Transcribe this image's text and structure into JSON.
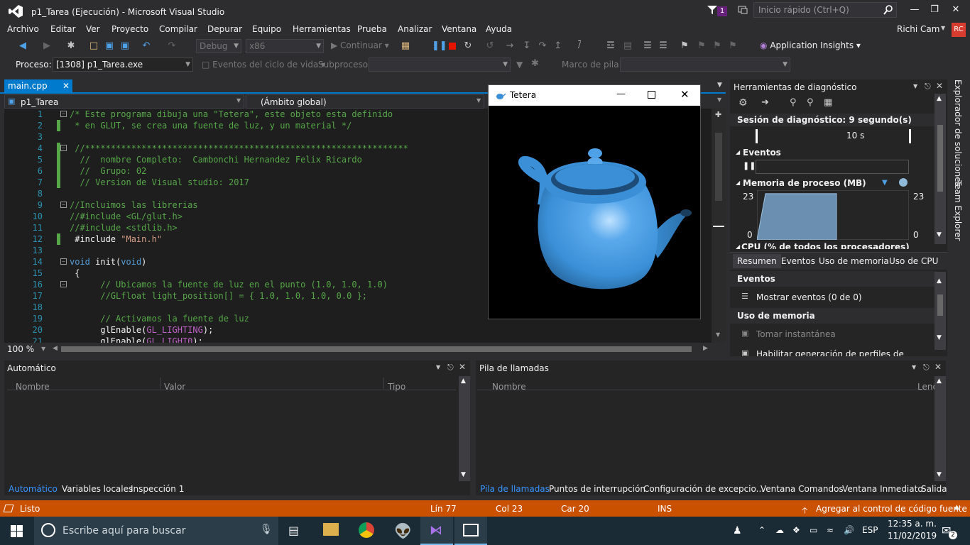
{
  "window": {
    "title": "p1_Tarea (Ejecución) - Microsoft Visual Studio",
    "notification_count": "1"
  },
  "quick_launch": {
    "placeholder": "Inicio rápido (Ctrl+Q)"
  },
  "menu": [
    "Archivo",
    "Editar",
    "Ver",
    "Proyecto",
    "Compilar",
    "Depurar",
    "Equipo",
    "Herramientas",
    "Prueba",
    "Analizar",
    "Ventana",
    "Ayuda"
  ],
  "user": {
    "name": "Richi Cam",
    "initials": "RC"
  },
  "toolbar": {
    "config": "Debug",
    "platform": "x86",
    "continue_label": "Continuar",
    "insights_label": "Application Insights"
  },
  "processbar": {
    "process_label": "Proceso:",
    "process_value": "[1308] p1_Tarea.exe",
    "lifecycle_label": "Eventos del ciclo de vida",
    "thread_label": "Subproceso:",
    "stack_label": "Marco de pila:"
  },
  "editor": {
    "tab": "main.cpp",
    "project": "p1_Tarea",
    "scope": "(Ámbito global)",
    "zoom": "100 %",
    "lines": [
      {
        "n": "1",
        "parts": [
          [
            "cmt",
            "/* Este programa dibuja una \"Tetera\", este objeto esta definido"
          ]
        ]
      },
      {
        "n": "2",
        "parts": [
          [
            "cmt",
            " * en GLUT, se crea una fuente de luz, y un material */"
          ]
        ]
      },
      {
        "n": "3",
        "parts": []
      },
      {
        "n": "4",
        "parts": [
          [
            "cmt",
            " //***************************************************************"
          ]
        ]
      },
      {
        "n": "5",
        "parts": [
          [
            "cmt",
            "  //  nombre Completo:  Cambonchi Hernandez Felix Ricardo"
          ]
        ]
      },
      {
        "n": "6",
        "parts": [
          [
            "cmt",
            "  //  Grupo: 02"
          ]
        ]
      },
      {
        "n": "7",
        "parts": [
          [
            "cmt",
            "  // Version de Visual studio: 2017"
          ]
        ]
      },
      {
        "n": "8",
        "parts": []
      },
      {
        "n": "9",
        "parts": [
          [
            "cmt",
            "//Incluimos las librerias"
          ]
        ]
      },
      {
        "n": "10",
        "parts": [
          [
            "cmt",
            "//#include <GL/glut.h>"
          ]
        ]
      },
      {
        "n": "11",
        "parts": [
          [
            "cmt",
            "//#include <stdlib.h>"
          ]
        ]
      },
      {
        "n": "12",
        "parts": [
          [
            "plain",
            " #include "
          ],
          [
            "str",
            "\"Main.h\""
          ]
        ]
      },
      {
        "n": "13",
        "parts": []
      },
      {
        "n": "14",
        "parts": [
          [
            "kw",
            "void"
          ],
          [
            "plain",
            " init("
          ],
          [
            "kw",
            "void"
          ],
          [
            "plain",
            ")"
          ]
        ]
      },
      {
        "n": "15",
        "parts": [
          [
            "plain",
            " {"
          ]
        ]
      },
      {
        "n": "16",
        "parts": [
          [
            "cmt",
            "      // Ubicamos la fuente de luz en el punto (1.0, 1.0, 1.0)"
          ]
        ]
      },
      {
        "n": "17",
        "parts": [
          [
            "cmt",
            "      //GLfloat light_position[] = { 1.0, 1.0, 1.0, 0.0 };"
          ]
        ]
      },
      {
        "n": "18",
        "parts": []
      },
      {
        "n": "19",
        "parts": [
          [
            "cmt",
            "      // Activamos la fuente de luz"
          ]
        ]
      },
      {
        "n": "20",
        "parts": [
          [
            "plain",
            "      glEnable("
          ],
          [
            "mac",
            "GL_LIGHTING"
          ],
          [
            "plain",
            ");"
          ]
        ]
      },
      {
        "n": "21",
        "parts": [
          [
            "plain",
            "      glEnable("
          ],
          [
            "mac",
            "GL_LIGHT0"
          ],
          [
            "plain",
            ");"
          ]
        ]
      }
    ]
  },
  "tetera": {
    "title": "Tetera"
  },
  "diagnostics": {
    "title": "Herramientas de diagnóstico",
    "session": "Sesión de diagnóstico: 9 segundo(s)",
    "timeline_label": "10 s",
    "events_header": "Eventos",
    "memory_header": "Memoria de proceso (MB)",
    "memory_max": "23",
    "memory_min": "0",
    "memory_usage_fraction": 0.93,
    "cpu_header": "CPU (% de todos los procesadores)",
    "tabs": [
      "Resumen",
      "Eventos",
      "Uso de memoria",
      "Uso de CPU"
    ],
    "summary_events": "Eventos",
    "show_events": "Mostrar eventos (0 de 0)",
    "memory_usage": "Uso de memoria",
    "snapshot": "Tomar instantánea",
    "heap_profiling": "Habilitar generación de perfiles de montón (a"
  },
  "right_tabs": [
    "Explorador de soluciones",
    "Team Explorer"
  ],
  "auto_panel": {
    "title": "Automático",
    "columns": [
      "Nombre",
      "Valor",
      "Tipo"
    ],
    "tabs": [
      "Automático",
      "Variables locales",
      "Inspección 1"
    ]
  },
  "stack_panel": {
    "title": "Pila de llamadas",
    "columns": [
      "Nombre",
      "Leng"
    ],
    "tabs": [
      "Pila de llamadas",
      "Puntos de interrupción",
      "Configuración de excepcio...",
      "Ventana Comandos",
      "Ventana Inmediato",
      "Salida"
    ]
  },
  "status": {
    "ready": "Listo",
    "line": "Lín 77",
    "col": "Col 23",
    "car": "Car 20",
    "ins": "INS",
    "source_control": "Agregar al control de código fuente"
  },
  "taskbar": {
    "search_placeholder": "Escribe aquí para buscar",
    "lang": "ESP",
    "time": "12:35 a. m.",
    "date": "11/02/2019",
    "notif_count": "2"
  },
  "colors": {
    "accent": "#007acc",
    "status": "#ca5100",
    "teapot": "#3a8fd6"
  }
}
